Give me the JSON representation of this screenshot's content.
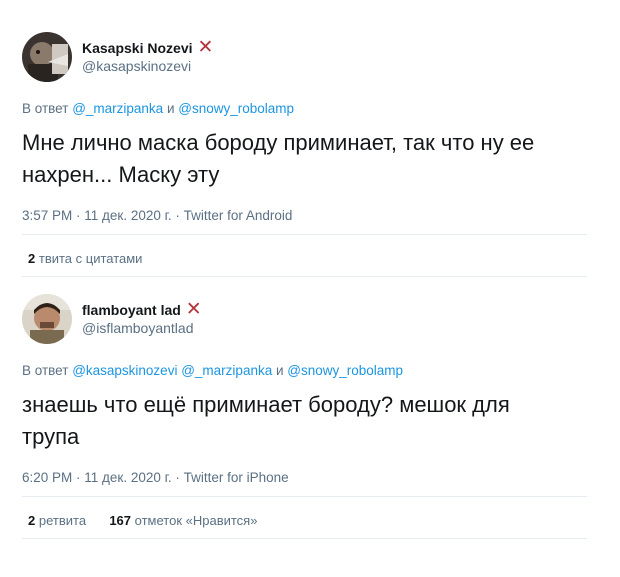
{
  "tweet1": {
    "name": "Kasapski Nozevi",
    "handle": "@kasapskinozevi",
    "reply_prefix": "В ответ",
    "reply_m1": "@_marzipanka",
    "reply_and": "и",
    "reply_m2": "@snowy_robolamp",
    "text_l1": "Мне лично маска бороду приминает, так что ну ее",
    "text_l2": "нахрен... Маску эту",
    "meta": "3:57 PM · 11 дек. 2020 г. · Twitter for Android"
  },
  "quotes": {
    "count": "2",
    "label": "твита с цитатами"
  },
  "tweet2": {
    "name": "flamboyant lad",
    "handle": "@isflamboyantlad",
    "reply_prefix": "В ответ",
    "reply_m1": "@kasapskinozevi",
    "reply_m2": "@_marzipanka",
    "reply_and": "и",
    "reply_m3": "@snowy_robolamp",
    "text_l1": "знаешь что ещё приминает бороду? мешок для",
    "text_l2": "трупа",
    "meta": "6:20 PM · 11 дек. 2020 г. · Twitter for iPhone"
  },
  "stats2": {
    "retweets_count": "2",
    "retweets_label": "ретвита",
    "likes_count": "167",
    "likes_label": "отметок «Нравится»"
  },
  "icons": {
    "badge": "red-x-icon"
  },
  "colors": {
    "mention": "#1b95e0",
    "secondary": "#5b7083",
    "x_mark": "#b3353d"
  }
}
